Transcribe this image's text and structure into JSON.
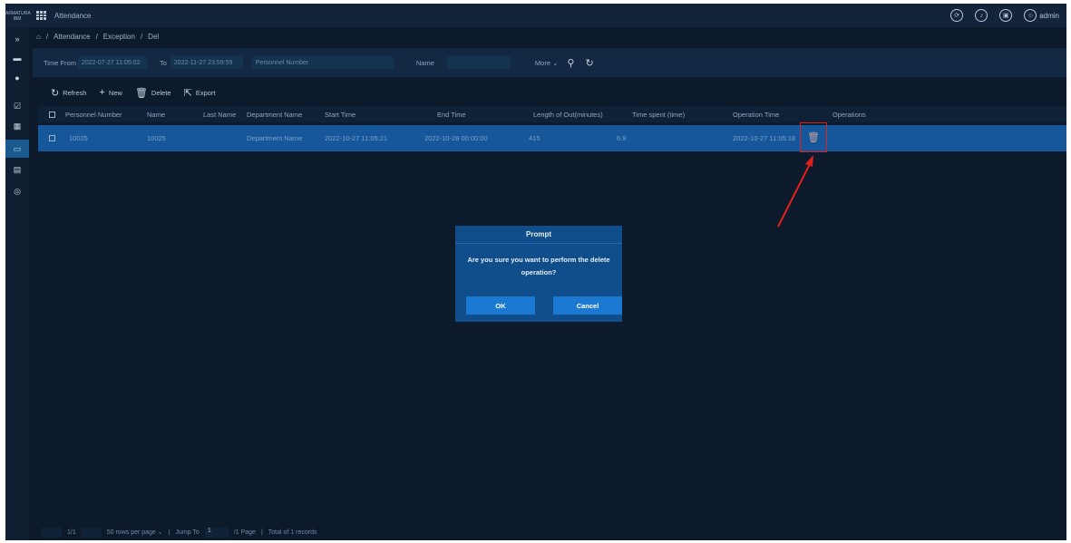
{
  "app": {
    "logo_text": "ARMATURA IBM",
    "title": "Attendance",
    "user": "admin"
  },
  "breadcrumb": {
    "items": [
      "Attendance",
      "Exception",
      "Del"
    ]
  },
  "filter": {
    "time_from_label": "Time From",
    "time_from_value": "2022-07-27 11:05:02",
    "to_label": "To",
    "to_value": "2022-11-27 23:59:59",
    "personnel_number_placeholder": "Personnel Number",
    "name_label": "Name",
    "more_label": "More"
  },
  "toolbar": {
    "refresh": "Refresh",
    "new": "New",
    "delete": "Delete",
    "export": "Export"
  },
  "table": {
    "columns": [
      "Personnel Number",
      "Name",
      "Last Name",
      "Department Name",
      "Start Time",
      "End Time",
      "Length of Out(minutes)",
      "Time spent (time)",
      "Operation Time",
      "Operations"
    ],
    "rows": [
      [
        "10025",
        "10025",
        "",
        "Department Name",
        "2022-10-27 11:05:21",
        "2022-10-28 00:00:00",
        "415",
        "6.9",
        "2022-10-27 11:05:18",
        ""
      ]
    ]
  },
  "pager": {
    "page": "1/1",
    "per_page": "50 rows per page",
    "jump_to": "Jump To",
    "jump_value": "1",
    "page_suffix": "/1 Page",
    "total": "Total of 1 records"
  },
  "dialog": {
    "title": "Prompt",
    "message": "Are you sure you want to perform the delete operation?",
    "ok": "OK",
    "cancel": "Cancel"
  },
  "colors": {
    "background": "#0d1a2b",
    "selected_row": "#15579a",
    "dialog": "#0f4e8a",
    "button": "#1b79d1",
    "highlight": "#e0201a"
  }
}
